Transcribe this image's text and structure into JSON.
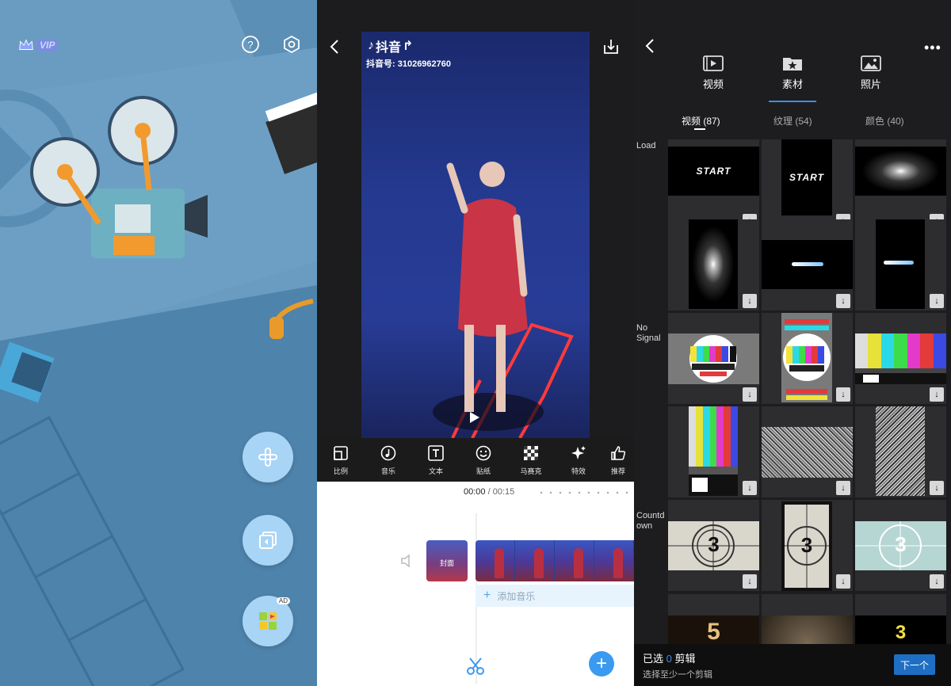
{
  "home": {
    "vip_label": "VIP"
  },
  "editor": {
    "watermark_app": "抖音",
    "watermark_id": "抖音号: 31026962760",
    "tools": [
      {
        "label": "比例",
        "icon": "ratio-icon"
      },
      {
        "label": "音乐",
        "icon": "music-icon"
      },
      {
        "label": "文本",
        "icon": "text-icon"
      },
      {
        "label": "贴纸",
        "icon": "sticker-icon"
      },
      {
        "label": "马赛克",
        "icon": "mosaic-icon"
      },
      {
        "label": "特效",
        "icon": "effects-icon"
      },
      {
        "label": "推荐",
        "icon": "thumbs-up-icon"
      }
    ],
    "time_current": "00:00",
    "time_separator": "/",
    "time_total": "00:15",
    "cover_label": "封面",
    "add_music_label": "添加音乐"
  },
  "library": {
    "categories": [
      {
        "label": "视频",
        "icon": "video-icon"
      },
      {
        "label": "素材",
        "icon": "material-icon"
      },
      {
        "label": "照片",
        "icon": "photo-icon"
      }
    ],
    "active_category": "素材",
    "subtabs": [
      "视频 (87)",
      "纹理 (54)",
      "颜色 (40)"
    ],
    "active_subtab": "视频 (87)",
    "sections": [
      {
        "label": "Load"
      },
      {
        "label": "No Signal"
      },
      {
        "label": "Countd own"
      }
    ],
    "start_text": "START",
    "countdown_numbers": [
      "3",
      "3",
      "3",
      "5",
      "3"
    ],
    "selected_prefix": "已选",
    "selected_count": "0",
    "selected_suffix": "剪辑",
    "selection_hint": "选择至少一个剪辑",
    "next_label": "下一个"
  },
  "colors": {
    "accent": "#3a8ee6",
    "home_bg": "#5c8fb6",
    "fab": "#a8d4f6",
    "dark_bg": "#1d1d1f"
  }
}
